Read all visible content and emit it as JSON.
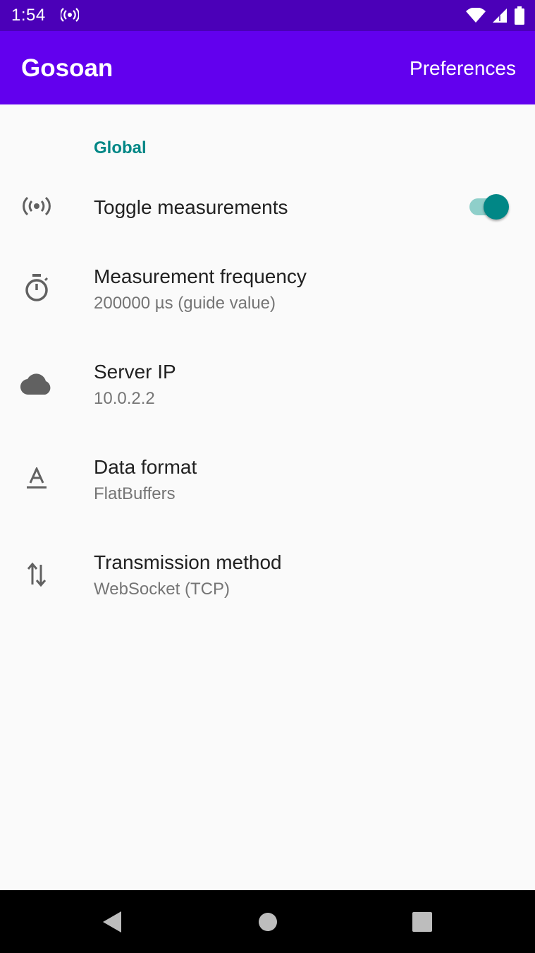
{
  "status_bar": {
    "time": "1:54",
    "icons": [
      "radio-signal-icon",
      "wifi-icon",
      "cell-signal-icon",
      "battery-icon"
    ],
    "background": "#4b00b8"
  },
  "app_bar": {
    "title": "Gosoan",
    "action_label": "Preferences",
    "background": "#6200ee"
  },
  "section": {
    "header": "Global",
    "header_color": "#018786"
  },
  "preferences": [
    {
      "icon": "radio-signal-icon",
      "title": "Toggle measurements",
      "switch_on": true
    },
    {
      "icon": "timer-icon",
      "title": "Measurement frequency",
      "summary": "200000 µs (guide value)"
    },
    {
      "icon": "cloud-icon",
      "title": "Server IP",
      "summary": "10.0.2.2"
    },
    {
      "icon": "text-format-icon",
      "title": "Data format",
      "summary": "FlatBuffers"
    },
    {
      "icon": "swap-vertical-icon",
      "title": "Transmission method",
      "summary": "WebSocket (TCP)"
    }
  ],
  "nav_bar": {
    "buttons": [
      "back-icon",
      "home-icon",
      "recents-icon"
    ]
  }
}
